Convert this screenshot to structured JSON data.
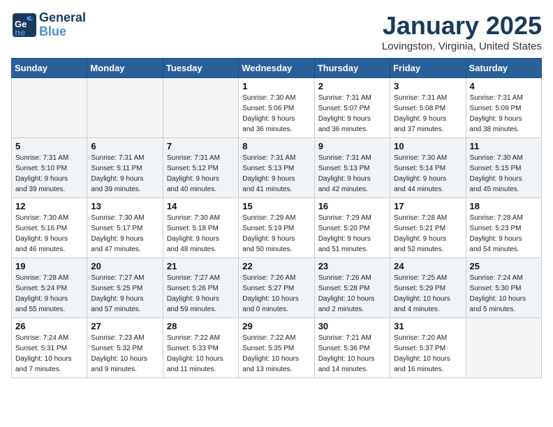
{
  "header": {
    "logo_line1": "General",
    "logo_line2": "Blue",
    "month_title": "January 2025",
    "location": "Lovingston, Virginia, United States"
  },
  "days_of_week": [
    "Sunday",
    "Monday",
    "Tuesday",
    "Wednesday",
    "Thursday",
    "Friday",
    "Saturday"
  ],
  "weeks": [
    [
      {
        "day": "",
        "info": ""
      },
      {
        "day": "",
        "info": ""
      },
      {
        "day": "",
        "info": ""
      },
      {
        "day": "1",
        "info": "Sunrise: 7:30 AM\nSunset: 5:06 PM\nDaylight: 9 hours\nand 36 minutes."
      },
      {
        "day": "2",
        "info": "Sunrise: 7:31 AM\nSunset: 5:07 PM\nDaylight: 9 hours\nand 36 minutes."
      },
      {
        "day": "3",
        "info": "Sunrise: 7:31 AM\nSunset: 5:08 PM\nDaylight: 9 hours\nand 37 minutes."
      },
      {
        "day": "4",
        "info": "Sunrise: 7:31 AM\nSunset: 5:09 PM\nDaylight: 9 hours\nand 38 minutes."
      }
    ],
    [
      {
        "day": "5",
        "info": "Sunrise: 7:31 AM\nSunset: 5:10 PM\nDaylight: 9 hours\nand 39 minutes."
      },
      {
        "day": "6",
        "info": "Sunrise: 7:31 AM\nSunset: 5:11 PM\nDaylight: 9 hours\nand 39 minutes."
      },
      {
        "day": "7",
        "info": "Sunrise: 7:31 AM\nSunset: 5:12 PM\nDaylight: 9 hours\nand 40 minutes."
      },
      {
        "day": "8",
        "info": "Sunrise: 7:31 AM\nSunset: 5:13 PM\nDaylight: 9 hours\nand 41 minutes."
      },
      {
        "day": "9",
        "info": "Sunrise: 7:31 AM\nSunset: 5:13 PM\nDaylight: 9 hours\nand 42 minutes."
      },
      {
        "day": "10",
        "info": "Sunrise: 7:30 AM\nSunset: 5:14 PM\nDaylight: 9 hours\nand 44 minutes."
      },
      {
        "day": "11",
        "info": "Sunrise: 7:30 AM\nSunset: 5:15 PM\nDaylight: 9 hours\nand 45 minutes."
      }
    ],
    [
      {
        "day": "12",
        "info": "Sunrise: 7:30 AM\nSunset: 5:16 PM\nDaylight: 9 hours\nand 46 minutes."
      },
      {
        "day": "13",
        "info": "Sunrise: 7:30 AM\nSunset: 5:17 PM\nDaylight: 9 hours\nand 47 minutes."
      },
      {
        "day": "14",
        "info": "Sunrise: 7:30 AM\nSunset: 5:18 PM\nDaylight: 9 hours\nand 48 minutes."
      },
      {
        "day": "15",
        "info": "Sunrise: 7:29 AM\nSunset: 5:19 PM\nDaylight: 9 hours\nand 50 minutes."
      },
      {
        "day": "16",
        "info": "Sunrise: 7:29 AM\nSunset: 5:20 PM\nDaylight: 9 hours\nand 51 minutes."
      },
      {
        "day": "17",
        "info": "Sunrise: 7:28 AM\nSunset: 5:21 PM\nDaylight: 9 hours\nand 52 minutes."
      },
      {
        "day": "18",
        "info": "Sunrise: 7:28 AM\nSunset: 5:23 PM\nDaylight: 9 hours\nand 54 minutes."
      }
    ],
    [
      {
        "day": "19",
        "info": "Sunrise: 7:28 AM\nSunset: 5:24 PM\nDaylight: 9 hours\nand 55 minutes."
      },
      {
        "day": "20",
        "info": "Sunrise: 7:27 AM\nSunset: 5:25 PM\nDaylight: 9 hours\nand 57 minutes."
      },
      {
        "day": "21",
        "info": "Sunrise: 7:27 AM\nSunset: 5:26 PM\nDaylight: 9 hours\nand 59 minutes."
      },
      {
        "day": "22",
        "info": "Sunrise: 7:26 AM\nSunset: 5:27 PM\nDaylight: 10 hours\nand 0 minutes."
      },
      {
        "day": "23",
        "info": "Sunrise: 7:26 AM\nSunset: 5:28 PM\nDaylight: 10 hours\nand 2 minutes."
      },
      {
        "day": "24",
        "info": "Sunrise: 7:25 AM\nSunset: 5:29 PM\nDaylight: 10 hours\nand 4 minutes."
      },
      {
        "day": "25",
        "info": "Sunrise: 7:24 AM\nSunset: 5:30 PM\nDaylight: 10 hours\nand 5 minutes."
      }
    ],
    [
      {
        "day": "26",
        "info": "Sunrise: 7:24 AM\nSunset: 5:31 PM\nDaylight: 10 hours\nand 7 minutes."
      },
      {
        "day": "27",
        "info": "Sunrise: 7:23 AM\nSunset: 5:32 PM\nDaylight: 10 hours\nand 9 minutes."
      },
      {
        "day": "28",
        "info": "Sunrise: 7:22 AM\nSunset: 5:33 PM\nDaylight: 10 hours\nand 11 minutes."
      },
      {
        "day": "29",
        "info": "Sunrise: 7:22 AM\nSunset: 5:35 PM\nDaylight: 10 hours\nand 13 minutes."
      },
      {
        "day": "30",
        "info": "Sunrise: 7:21 AM\nSunset: 5:36 PM\nDaylight: 10 hours\nand 14 minutes."
      },
      {
        "day": "31",
        "info": "Sunrise: 7:20 AM\nSunset: 5:37 PM\nDaylight: 10 hours\nand 16 minutes."
      },
      {
        "day": "",
        "info": ""
      }
    ]
  ]
}
